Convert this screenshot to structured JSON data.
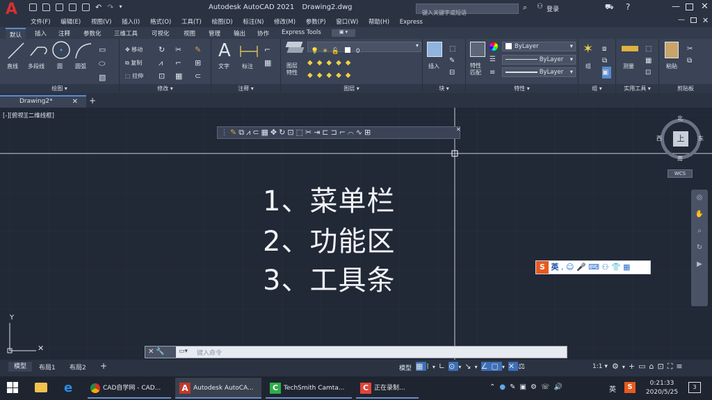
{
  "title_bar": {
    "app_title": "Autodesk AutoCAD 2021",
    "document_title": "Drawing2.dwg",
    "search_placeholder": "键入关键字或短语",
    "login_label": "登录"
  },
  "menu_items": [
    "文件(F)",
    "编辑(E)",
    "视图(V)",
    "插入(I)",
    "格式(O)",
    "工具(T)",
    "绘图(D)",
    "标注(N)",
    "修改(M)",
    "参数(P)",
    "窗口(W)",
    "帮助(H)",
    "Express"
  ],
  "ribbon_tabs": [
    "默认",
    "插入",
    "注释",
    "参数化",
    "三维工具",
    "可视化",
    "视图",
    "管理",
    "输出",
    "协作",
    "Express Tools"
  ],
  "ribbon": {
    "draw": {
      "title": "绘图",
      "tools": [
        "直线",
        "多段线",
        "圆",
        "圆弧"
      ]
    },
    "modify": {
      "title": "修改",
      "tools": [
        "移动",
        "复制",
        "拉伸"
      ]
    },
    "annotation": {
      "title": "注释",
      "tools": [
        "文字",
        "标注"
      ]
    },
    "layers": {
      "title": "图层",
      "layer_props": "图层\n特性",
      "current_layer": "0"
    },
    "block": {
      "title": "块",
      "insert": "插入"
    },
    "properties": {
      "title": "特性",
      "match": "特性\n匹配",
      "color": "ByLayer",
      "linetype": "ByLayer",
      "lineweight": "ByLayer"
    },
    "groups": {
      "title": "组",
      "group": "组"
    },
    "utilities": {
      "title": "实用工具",
      "measure": "测量"
    },
    "clipboard": {
      "title": "剪贴板",
      "paste": "粘贴"
    }
  },
  "document_tab": "Drawing2*",
  "viewport_label": "[-][俯视][二维线框]",
  "viewcube": {
    "north": "北",
    "south": "南",
    "east": "东",
    "west": "西",
    "top": "上",
    "wcs": "WCS"
  },
  "overlay_text": [
    "1、菜单栏",
    "2、功能区",
    "3、工具条"
  ],
  "command_line_placeholder": "键入命令",
  "layout_tabs": [
    "模型",
    "布局1",
    "布局2"
  ],
  "status_bar": {
    "model_label": "模型",
    "scale": "1:1"
  },
  "ime_label": "英",
  "taskbar": {
    "apps": [
      "CAD自学网 - CAD...",
      "Autodesk AutoCA...",
      "TechSmith Camta...",
      "正在录制..."
    ],
    "ime": "英",
    "time": "0:21:33",
    "date": "2020/5/25",
    "notifications": "3"
  },
  "colors": {
    "accent": "#c0392b",
    "canvas": "#212836",
    "ribbon": "#3a4456"
  }
}
